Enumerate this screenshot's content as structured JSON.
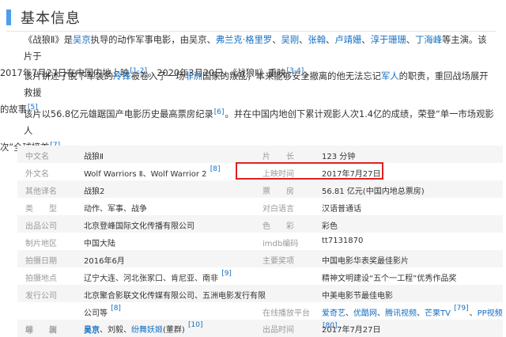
{
  "header": {
    "title": "基本信息"
  },
  "para1": {
    "t1": "《战狼Ⅱ》是",
    "link_wujing": "吴京",
    "t2": "执导的动作军事电影，由吴京、",
    "link_frank": "弗兰克·格里罗",
    "sep1": "、",
    "link_wugang": "吴刚",
    "sep2": "、",
    "link_zhangyi": "张翰",
    "sep3": "、",
    "link_lu": "卢靖姗",
    "sep4": "、",
    "link_chunyu": "淳于珊珊",
    "sep5": "、",
    "link_ding": "丁海峰",
    "t3": "等主演。该片于",
    "t4": "2017年7月27日在中国内地上映",
    "ref1": "[1-2]",
    "t5": "。2020年3月20日，《战狼Ⅱ》重映",
    "ref2": "[3-4]",
    "t6": "。"
  },
  "para2": {
    "t1": "该片讲述了脱下军装的",
    "link_lengfeng": "冷锋",
    "t2": "被卷入了一场",
    "link_africa": "非洲",
    "t3": "国家的叛乱，本来能够安全撤离的他无法忘记",
    "link_soldier": "军人",
    "t4": "的职责，重回战场展开救援",
    "t5": "的故事",
    "ref": "[5]"
  },
  "para3": {
    "t1": "该片以56.8亿元雄踞国产电影历史最高票房纪录",
    "ref1": "[6]",
    "t2": "。并在中国内地创下累计观影人次1.4亿的成绩，荣登“单一市场观影人",
    "t3": "次”全球榜首",
    "ref2": "[7]"
  },
  "info": {
    "r1": {
      "l1": "中文名",
      "v1": "战狼Ⅱ",
      "l2": "片　　长",
      "v2": "123 分钟"
    },
    "r2": {
      "l1": "外文名",
      "v1": "Wolf Warriors Ⅱ、Wolf Warrior 2",
      "ref1": "[8]",
      "l2": "上映时间",
      "v2": "2017年7月27日"
    },
    "r3": {
      "l1": "其他译名",
      "v1": "战狼2",
      "l2": "票　　房",
      "v2": "56.81 亿元(中国内地总票房)"
    },
    "r4": {
      "l1": "类　　型",
      "v1": "动作、军事、战争",
      "l2": "对白语言",
      "v2": "汉语普通话"
    },
    "r5": {
      "l1": "出品公司",
      "v1": "北京登峰国际文化传播有限公司",
      "l2": "色　　彩",
      "v2": "彩色"
    },
    "r6": {
      "l1": "制片地区",
      "v1": "中国大陆",
      "l2": "imdb编码",
      "v2": "tt7131870"
    },
    "r7": {
      "l1": "拍摄日期",
      "v1": "2016年6月",
      "l2": "主要奖项",
      "v2": "中国电影华表奖最佳影片"
    },
    "r8": {
      "l1": "拍摄地点",
      "v1": "辽宁大连、河北张家口、肯尼亚、南非",
      "ref1": "[9]",
      "v2": "精神文明建设“五个一工程”优秀作品奖"
    },
    "r9": {
      "l1": "发行公司",
      "v1": "北京聚合影联文化传媒有限公司、五洲电影发行有限",
      "v2": "中美电影节最佳电影"
    },
    "r10": {
      "v1": "公司等",
      "ref1": "[8]",
      "l2": "在线播放平台",
      "link1": "爱奇艺",
      "sep1": "、",
      "link2": "优酷网",
      "sep2": "、",
      "link3": "腾讯视频",
      "sep3": "、",
      "link4": "芒果TV",
      "ref2": "[79]",
      "sep4": "、",
      "link5": "PP视频"
    },
    "r11": {
      "l1": "导　　演",
      "link1": "吴京",
      "ref2": "[80]"
    },
    "r12": {
      "l1": "编　　剧",
      "link1": "吴京",
      "t1": "、刘毅、",
      "link2": "纷舞妖姬",
      "t2": "(董群)",
      "ref1": "[10]",
      "l2": "出品时间",
      "v2": "2017年7月27日"
    }
  }
}
